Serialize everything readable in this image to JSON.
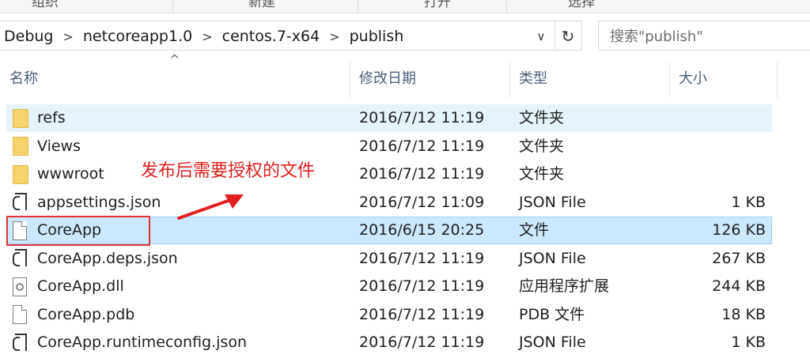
{
  "ribbon": {
    "labels": [
      "组织",
      "新建",
      "打开",
      "选择"
    ]
  },
  "address": {
    "crumbs": [
      "Debug",
      "netcoreapp1.0",
      "centos.7-x64",
      "publish"
    ],
    "separator": ">",
    "dropdown_icon": "chevron-down-icon",
    "refresh_icon": "refresh-icon"
  },
  "search": {
    "placeholder": "搜索\"publish\""
  },
  "columns": {
    "name": "名称",
    "date": "修改日期",
    "type": "类型",
    "size": "大小",
    "sort_indicator": "^"
  },
  "files": [
    {
      "name": "refs",
      "date": "2016/7/12 11:19",
      "type": "文件夹",
      "size": "",
      "icon": "folder-icon",
      "state": "hover"
    },
    {
      "name": "Views",
      "date": "2016/7/12 11:19",
      "type": "文件夹",
      "size": "",
      "icon": "folder-icon",
      "state": ""
    },
    {
      "name": "wwwroot",
      "date": "2016/7/12 11:19",
      "type": "文件夹",
      "size": "",
      "icon": "folder-icon",
      "state": ""
    },
    {
      "name": "appsettings.json",
      "date": "2016/7/12 11:09",
      "type": "JSON File",
      "size": "1 KB",
      "icon": "json-file-icon",
      "state": ""
    },
    {
      "name": "CoreApp",
      "date": "2016/6/15 20:25",
      "type": "文件",
      "size": "126 KB",
      "icon": "file-icon",
      "state": "selected"
    },
    {
      "name": "CoreApp.deps.json",
      "date": "2016/7/12 11:19",
      "type": "JSON File",
      "size": "267 KB",
      "icon": "json-file-icon",
      "state": ""
    },
    {
      "name": "CoreApp.dll",
      "date": "2016/7/12 11:19",
      "type": "应用程序扩展",
      "size": "244 KB",
      "icon": "dll-file-icon",
      "state": ""
    },
    {
      "name": "CoreApp.pdb",
      "date": "2016/7/12 11:19",
      "type": "PDB 文件",
      "size": "18 KB",
      "icon": "file-icon",
      "state": ""
    },
    {
      "name": "CoreApp.runtimeconfig.json",
      "date": "2016/7/12 11:19",
      "type": "JSON File",
      "size": "1 KB",
      "icon": "json-file-icon",
      "state": ""
    }
  ],
  "annotation": {
    "text": "发布后需要授权的文件",
    "color": "#e02020"
  },
  "colors": {
    "hover_row": "#e5f3fb",
    "selected_row": "#cce8ff",
    "header_text": "#4c607a"
  }
}
